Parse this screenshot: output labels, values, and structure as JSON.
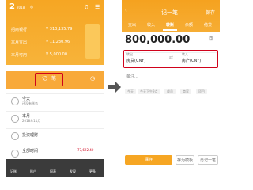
{
  "left": {
    "date_day": "2",
    "date_year": "2018",
    "balances": [
      {
        "label": "招商银行",
        "value": "¥ 313,135.79"
      },
      {
        "label": "本月支出",
        "value": "¥ 11,230.96"
      },
      {
        "label": "本月可用",
        "value": "¥ 5,000.00"
      }
    ],
    "record_button": "记一笔",
    "rows": [
      {
        "title": "今天",
        "sub": "还没有账务",
        "amount": ""
      },
      {
        "title": "本月",
        "sub": "2018年11月",
        "amount": ""
      },
      {
        "title": "投资理财",
        "sub": "",
        "amount": ""
      },
      {
        "title": "全部时间",
        "sub": "",
        "amount": "77,622.40"
      }
    ],
    "nav": [
      "记账",
      "账户",
      "报表",
      "发现",
      "更多"
    ]
  },
  "right": {
    "title": "记一笔",
    "back_icon": "back-arrow-icon",
    "save": "保存",
    "tabs": [
      "支出",
      "收入",
      "转账",
      "余额",
      "借贷"
    ],
    "amount": "800,000.00",
    "from_label": "转出",
    "from_value": "房贷(CNY)",
    "to_label": "转入",
    "to_value": "房产(CNY)",
    "memo_placeholder": "备注...",
    "tags": [
      "今天",
      "今天下午9点",
      "成员",
      "商家",
      "项目"
    ],
    "save_button": "保存",
    "save_template_button": "存为模板",
    "save_again_button": "再记一笔"
  },
  "colors": {
    "accent": "#f6a623",
    "highlight": "#d0021b"
  }
}
